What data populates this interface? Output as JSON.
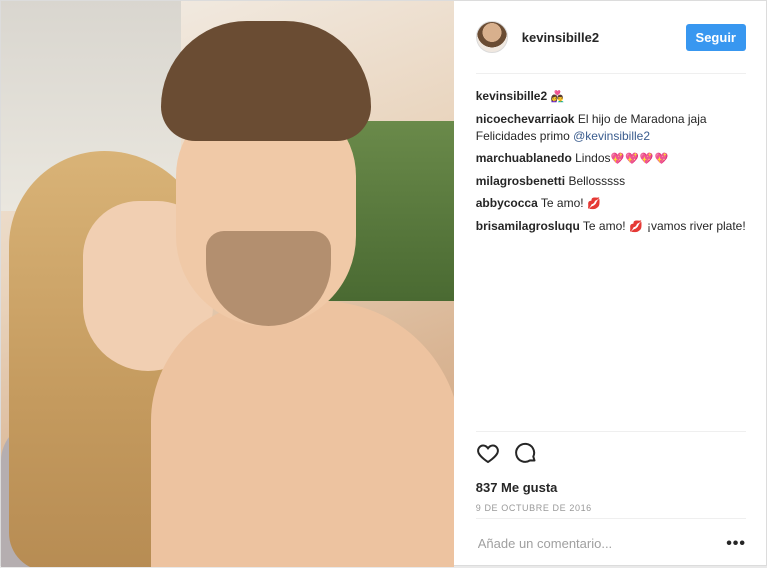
{
  "header": {
    "username": "kevinsibille2",
    "follow_label": "Seguir"
  },
  "caption": {
    "user": "kevinsibille2",
    "emoji": "👩‍❤️‍👨"
  },
  "comments": [
    {
      "user": "nicoechevarriaok",
      "text": "El hijo de Maradona jaja Felicidades primo ",
      "mention": "@kevinsibille2"
    },
    {
      "user": "marchuablanedo",
      "text": "Lindos",
      "emoji": "💖💖💖💖"
    },
    {
      "user": "milagrosbenetti",
      "text": "Bellosssss"
    },
    {
      "user": "abbycocca",
      "text": "Te amo!",
      "emoji": "💋"
    },
    {
      "user": "brisamilagrosluqu",
      "text": "Te amo!",
      "emoji": "💋",
      "text2": "¡vamos river plate!"
    }
  ],
  "icons": {
    "like": "heart-icon",
    "comment": "comment-bubble-icon",
    "more": "more-options-icon"
  },
  "likes": "837 Me gusta",
  "date": "9 DE OCTUBRE DE 2016",
  "add_comment": {
    "placeholder": "Añade un comentario...",
    "more_label": "•••"
  },
  "colors": {
    "follow_button": "#3897f0",
    "mention": "#3a5c8e"
  }
}
